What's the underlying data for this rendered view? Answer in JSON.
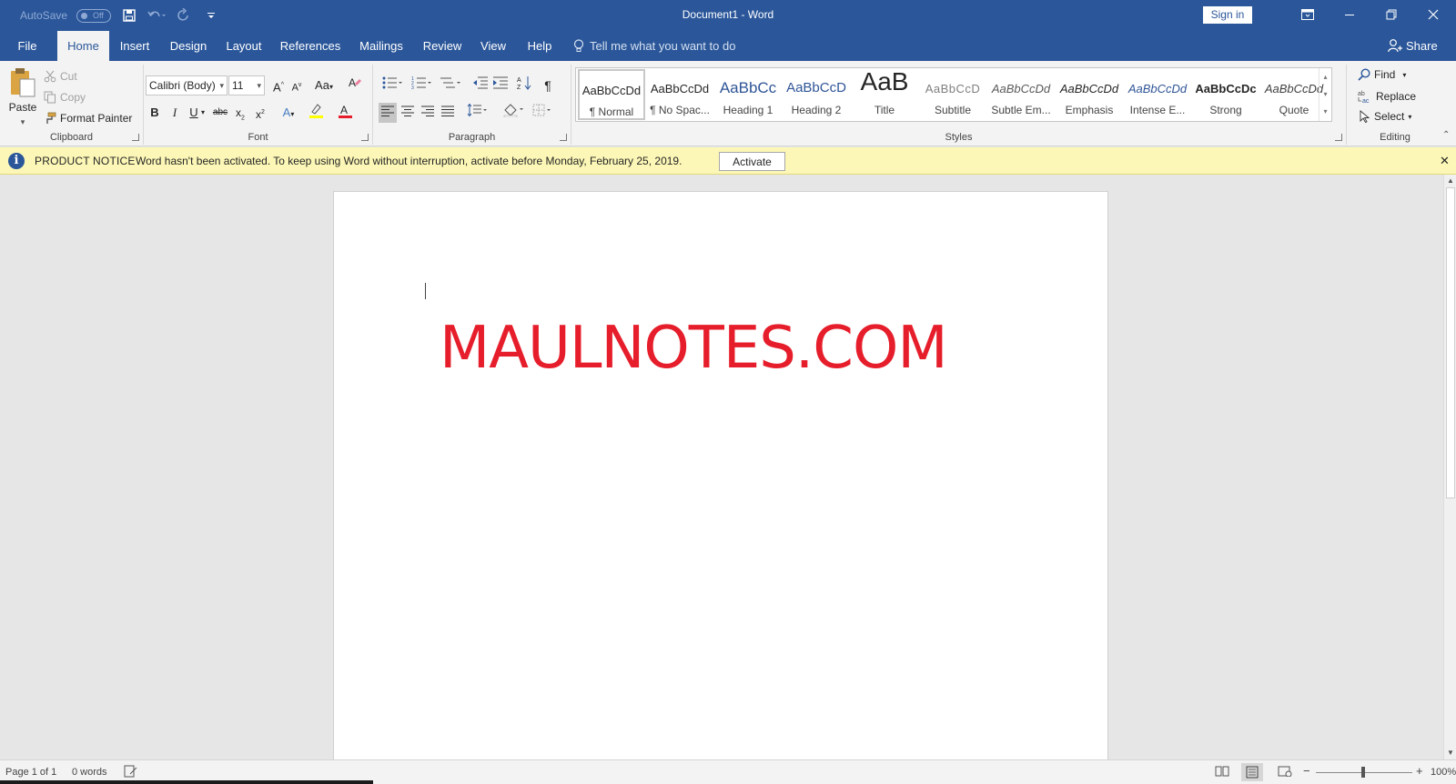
{
  "titlebar": {
    "autosave_label": "AutoSave",
    "autosave_state": "Off",
    "document_title": "Document1  -  Word",
    "sign_in": "Sign in"
  },
  "tabs": [
    {
      "label": "File"
    },
    {
      "label": "Home"
    },
    {
      "label": "Insert"
    },
    {
      "label": "Design"
    },
    {
      "label": "Layout"
    },
    {
      "label": "References"
    },
    {
      "label": "Mailings"
    },
    {
      "label": "Review"
    },
    {
      "label": "View"
    },
    {
      "label": "Help"
    }
  ],
  "active_tab": "Home",
  "tell_me": "Tell me what you want to do",
  "share": "Share",
  "clipboard": {
    "paste": "Paste",
    "cut": "Cut",
    "copy": "Copy",
    "format_painter": "Format Painter",
    "label": "Clipboard"
  },
  "font": {
    "font_name": "Calibri (Body)",
    "font_size": "11",
    "case_label": "Aa",
    "label": "Font"
  },
  "paragraph": {
    "label": "Paragraph"
  },
  "styles": {
    "label": "Styles",
    "items": [
      {
        "sample": "AaBbCcDd",
        "name": "¶ Normal"
      },
      {
        "sample": "AaBbCcDd",
        "name": "¶ No Spac..."
      },
      {
        "sample": "AaBbCc",
        "name": "Heading 1"
      },
      {
        "sample": "AaBbCcD",
        "name": "Heading 2"
      },
      {
        "sample": "AaB",
        "name": "Title"
      },
      {
        "sample": "AaBbCcD",
        "name": "Subtitle"
      },
      {
        "sample": "AaBbCcDd",
        "name": "Subtle Em..."
      },
      {
        "sample": "AaBbCcDd",
        "name": "Emphasis"
      },
      {
        "sample": "AaBbCcDd",
        "name": "Intense E..."
      },
      {
        "sample": "AaBbCcDc",
        "name": "Strong"
      },
      {
        "sample": "AaBbCcDd",
        "name": "Quote"
      }
    ]
  },
  "editing": {
    "find": "Find",
    "replace": "Replace",
    "select": "Select",
    "label": "Editing"
  },
  "notice": {
    "title": "PRODUCT NOTICE",
    "message": "Word hasn't been activated. To keep using Word without interruption, activate before Monday, February 25, 2019.",
    "button": "Activate"
  },
  "document": {
    "text": "MAULNOTES.COM",
    "text_color": "#e61e2b"
  },
  "statusbar": {
    "page": "Page 1 of 1",
    "words": "0 words",
    "zoom": "100%"
  },
  "colors": {
    "brand": "#2b579a",
    "notice_bg": "#fcf7b6"
  }
}
